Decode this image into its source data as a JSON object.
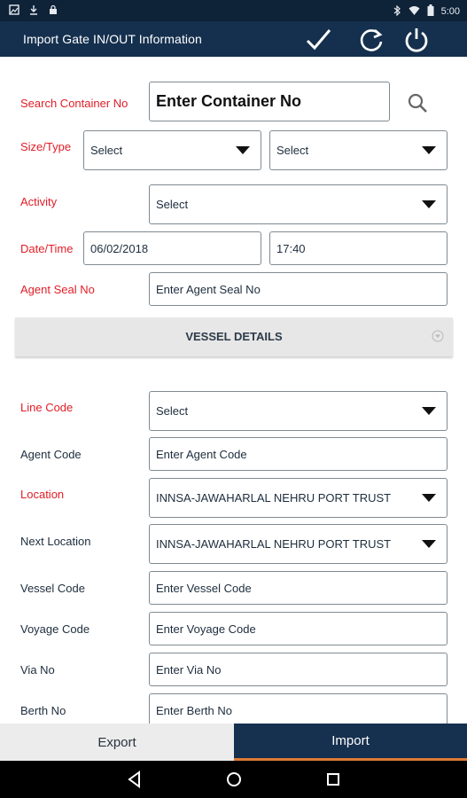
{
  "status_bar": {
    "time": "5:00"
  },
  "app_bar": {
    "title": "Import Gate IN/OUT Information",
    "actions": [
      "check-icon",
      "refresh-icon",
      "power-icon"
    ]
  },
  "form": {
    "search_container": {
      "label": "Search Container No",
      "placeholder": "Enter Container No"
    },
    "size_type": {
      "label": "Size/Type",
      "size_value": "Select",
      "type_value": "Select"
    },
    "activity": {
      "label": "Activity",
      "value": "Select"
    },
    "date_time": {
      "label": "Date/Time",
      "date": "06/02/2018",
      "time": "17:40"
    },
    "agent_seal": {
      "label": "Agent Seal No",
      "placeholder": "Enter Agent Seal No"
    },
    "vessel_details_header": "VESSEL DETAILS",
    "line_code": {
      "label": "Line Code",
      "value": "Select"
    },
    "agent_code": {
      "label": "Agent Code",
      "placeholder": "Enter Agent Code"
    },
    "location": {
      "label": "Location",
      "value": "INNSA-JAWAHARLAL NEHRU PORT TRUST"
    },
    "next_location": {
      "label": "Next Location",
      "value": "INNSA-JAWAHARLAL NEHRU PORT TRUST"
    },
    "vessel_code": {
      "label": "Vessel Code",
      "placeholder": "Enter Vessel Code"
    },
    "voyage_code": {
      "label": "Voyage Code",
      "placeholder": "Enter Voyage Code"
    },
    "via_no": {
      "label": "Via No",
      "placeholder": "Enter Via No"
    },
    "berth_no": {
      "label": "Berth No",
      "placeholder": "Enter Berth No"
    }
  },
  "tabs": {
    "export": "Export",
    "import": "Import",
    "selected": "import"
  },
  "colors": {
    "app_bar": "#15304e",
    "required_label": "#e21d27",
    "selected_tab": "#16304f",
    "tab_indicator": "#e07a35"
  }
}
